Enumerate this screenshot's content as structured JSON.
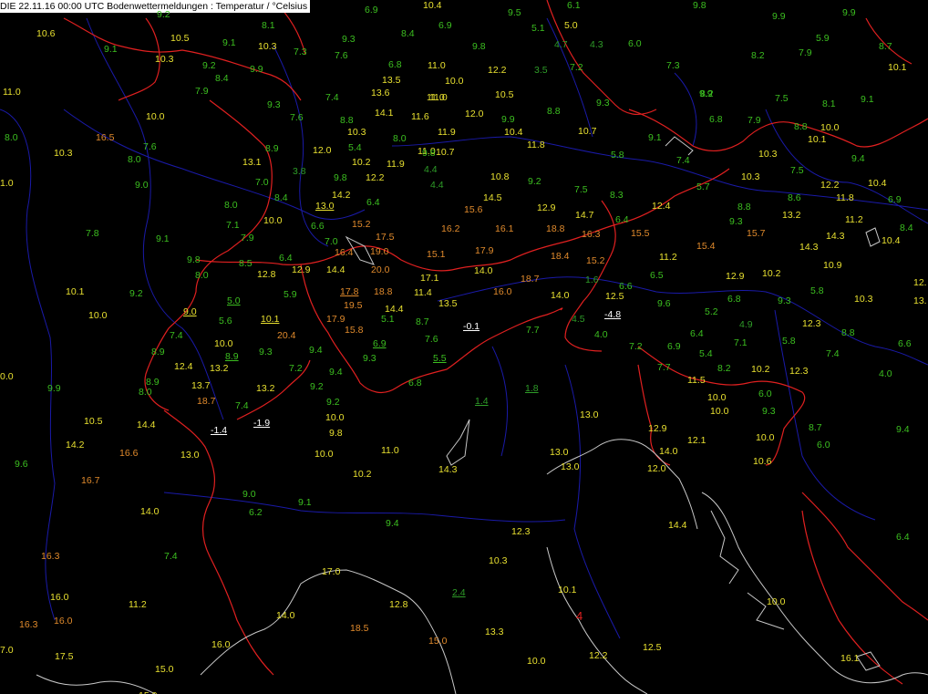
{
  "title": "DIE 22.11.16 00:00 UTC  Bodenwettermeldungen :  Temperatur / °Celsius",
  "colors": {
    "background": "#000000",
    "border_lines": "#e02020",
    "river_lines": "#1a1aa8",
    "coast_lines": "#c8c8c8",
    "green": "#3cbf20",
    "dark_green": "#2e9c28",
    "yellow": "#e8e030",
    "orange": "#e08a2c",
    "white": "#ffffff"
  },
  "marker": "4",
  "stations": [
    {
      "t": "9.2",
      "c": "g"
    },
    {
      "t": "6.9",
      "c": "g"
    },
    {
      "t": "10.4",
      "c": "y"
    },
    {
      "t": "9.5",
      "c": "g"
    },
    {
      "t": "6.1",
      "c": "g"
    },
    {
      "t": "9.9",
      "c": "g"
    },
    {
      "t": "9.9",
      "c": "g"
    },
    {
      "t": "10.6",
      "c": "y"
    },
    {
      "t": "8.1",
      "c": "g"
    },
    {
      "t": "9.3",
      "c": "g"
    },
    {
      "t": "8.4",
      "c": "g"
    },
    {
      "t": "6.9",
      "c": "g"
    },
    {
      "t": "5.1",
      "c": "g"
    },
    {
      "t": "5.0",
      "c": "y"
    },
    {
      "t": "9.8",
      "c": "g"
    },
    {
      "t": "10.5",
      "c": "y"
    },
    {
      "t": "9.1",
      "c": "g"
    },
    {
      "t": "10.3",
      "c": "y"
    },
    {
      "t": "7.3",
      "c": "g"
    },
    {
      "t": "4.7",
      "c": "dg"
    },
    {
      "t": "4.3",
      "c": "dg"
    },
    {
      "t": "6.0",
      "c": "g"
    },
    {
      "t": "5.9",
      "c": "g"
    },
    {
      "t": "8.7",
      "c": "g"
    },
    {
      "t": "9.1",
      "c": "g"
    },
    {
      "t": "10.3",
      "c": "y"
    },
    {
      "t": "7.6",
      "c": "g"
    },
    {
      "t": "9.8",
      "c": "g"
    },
    {
      "t": "8.2",
      "c": "g"
    },
    {
      "t": "7.9",
      "c": "g"
    },
    {
      "t": "9.2",
      "c": "g"
    },
    {
      "t": "9.9",
      "c": "g"
    },
    {
      "t": "6.8",
      "c": "g"
    },
    {
      "t": "11.0",
      "c": "y"
    },
    {
      "t": "12.2",
      "c": "y"
    },
    {
      "t": "3.5",
      "c": "dg"
    },
    {
      "t": "7.2",
      "c": "g"
    },
    {
      "t": "7.3",
      "c": "g"
    },
    {
      "t": "10.1",
      "c": "y"
    },
    {
      "t": "8.4",
      "c": "g"
    },
    {
      "t": "13.5",
      "c": "y"
    },
    {
      "t": "10.0",
      "c": "y"
    },
    {
      "t": "11.0",
      "c": "y"
    },
    {
      "t": "9.9",
      "c": "g"
    },
    {
      "t": "7.9",
      "c": "g"
    },
    {
      "t": "13.6",
      "c": "y"
    },
    {
      "t": "7.4",
      "c": "g"
    },
    {
      "t": "11.0",
      "c": "y"
    },
    {
      "t": "10.5",
      "c": "y"
    },
    {
      "t": "9.3",
      "c": "g"
    },
    {
      "t": "8.2",
      "c": "g"
    },
    {
      "t": "7.5",
      "c": "g"
    },
    {
      "t": "8.1",
      "c": "g"
    },
    {
      "t": "9.1",
      "c": "g"
    },
    {
      "t": "11.0",
      "c": "y"
    },
    {
      "t": "9.3",
      "c": "g"
    },
    {
      "t": "14.1",
      "c": "y"
    },
    {
      "t": "11.6",
      "c": "y"
    },
    {
      "t": "12.0",
      "c": "y"
    },
    {
      "t": "9.9",
      "c": "g"
    },
    {
      "t": "8.8",
      "c": "g"
    },
    {
      "t": "10.0",
      "c": "y"
    },
    {
      "t": "7.6",
      "c": "g"
    },
    {
      "t": "8.8",
      "c": "g"
    },
    {
      "t": "10.3",
      "c": "y"
    },
    {
      "t": "11.9",
      "c": "y"
    },
    {
      "t": "10.4",
      "c": "y"
    },
    {
      "t": "10.7",
      "c": "y"
    },
    {
      "t": "6.8",
      "c": "g"
    },
    {
      "t": "7.9",
      "c": "g"
    },
    {
      "t": "8.8",
      "c": "g"
    },
    {
      "t": "10.0",
      "c": "y"
    },
    {
      "t": "8.0",
      "c": "g"
    },
    {
      "t": "16.5",
      "c": "o"
    },
    {
      "t": "8.0",
      "c": "g"
    },
    {
      "t": "11.0",
      "c": "y"
    },
    {
      "t": "11.8",
      "c": "y"
    },
    {
      "t": "9.1",
      "c": "g"
    },
    {
      "t": "10.1",
      "c": "y"
    },
    {
      "t": "10.3",
      "c": "y"
    },
    {
      "t": "7.6",
      "c": "g"
    },
    {
      "t": "8.9",
      "c": "g"
    },
    {
      "t": "12.0",
      "c": "y"
    },
    {
      "t": "5.4",
      "c": "g"
    },
    {
      "t": "9.8",
      "c": "g"
    },
    {
      "t": "5.8",
      "c": "g"
    },
    {
      "t": "7.4",
      "c": "g"
    },
    {
      "t": "10.3",
      "c": "y"
    },
    {
      "t": "9.4",
      "c": "g"
    },
    {
      "t": "8.0",
      "c": "g"
    },
    {
      "t": "13.1",
      "c": "y"
    },
    {
      "t": "10.2",
      "c": "y"
    },
    {
      "t": "11.9",
      "c": "y"
    },
    {
      "t": "10.7",
      "c": "y"
    },
    {
      "t": "3.8",
      "c": "dg"
    },
    {
      "t": "4.4",
      "c": "dg"
    },
    {
      "t": "7.5",
      "c": "g"
    },
    {
      "t": "1.0",
      "c": "y"
    },
    {
      "t": "9.0",
      "c": "g"
    },
    {
      "t": "7.0",
      "c": "g"
    },
    {
      "t": "9.8",
      "c": "g"
    },
    {
      "t": "12.2",
      "c": "y"
    },
    {
      "t": "4.4",
      "c": "dg"
    },
    {
      "t": "10.8",
      "c": "y"
    },
    {
      "t": "9.2",
      "c": "g"
    },
    {
      "t": "5.7",
      "c": "g"
    },
    {
      "t": "10.3",
      "c": "y"
    },
    {
      "t": "12.2",
      "c": "y"
    },
    {
      "t": "10.4",
      "c": "y"
    },
    {
      "t": "8.4",
      "c": "g"
    },
    {
      "t": "14.2",
      "c": "y"
    },
    {
      "t": "14.5",
      "c": "y"
    },
    {
      "t": "7.5",
      "c": "g"
    },
    {
      "t": "8.3",
      "c": "g"
    },
    {
      "t": "8.6",
      "c": "g"
    },
    {
      "t": "11.8",
      "c": "y"
    },
    {
      "t": "6.9",
      "c": "g"
    },
    {
      "t": "8.0",
      "c": "g"
    },
    {
      "t": "13.0",
      "c": "y",
      "u": true
    },
    {
      "t": "6.4",
      "c": "g"
    },
    {
      "t": "15.6",
      "c": "o"
    },
    {
      "t": "12.9",
      "c": "y"
    },
    {
      "t": "12.4",
      "c": "y"
    },
    {
      "t": "8.8",
      "c": "g"
    },
    {
      "t": "13.2",
      "c": "y"
    },
    {
      "t": "10.0",
      "c": "y"
    },
    {
      "t": "14.7",
      "c": "y"
    },
    {
      "t": "6.4",
      "c": "g"
    },
    {
      "t": "9.3",
      "c": "g"
    },
    {
      "t": "11.2",
      "c": "y"
    },
    {
      "t": "8.4",
      "c": "g"
    },
    {
      "t": "7.1",
      "c": "g"
    },
    {
      "t": "6.6",
      "c": "g"
    },
    {
      "t": "15.2",
      "c": "o"
    },
    {
      "t": "16.2",
      "c": "o"
    },
    {
      "t": "16.1",
      "c": "o"
    },
    {
      "t": "18.8",
      "c": "o"
    },
    {
      "t": "15.5",
      "c": "o"
    },
    {
      "t": "15.7",
      "c": "o"
    },
    {
      "t": "7.8",
      "c": "g"
    },
    {
      "t": "9.1",
      "c": "g"
    },
    {
      "t": "7.9",
      "c": "g"
    },
    {
      "t": "7.0",
      "c": "g"
    },
    {
      "t": "17.5",
      "c": "o"
    },
    {
      "t": "16.3",
      "c": "o"
    },
    {
      "t": "14.3",
      "c": "y"
    },
    {
      "t": "10.4",
      "c": "y"
    },
    {
      "t": "16.4",
      "c": "o"
    },
    {
      "t": "19.0",
      "c": "o"
    },
    {
      "t": "15.1",
      "c": "o"
    },
    {
      "t": "17.9",
      "c": "o"
    },
    {
      "t": "15.4",
      "c": "o"
    },
    {
      "t": "14.3",
      "c": "y"
    },
    {
      "t": "9.8",
      "c": "g"
    },
    {
      "t": "8.5",
      "c": "g"
    },
    {
      "t": "6.4",
      "c": "g"
    },
    {
      "t": "18.4",
      "c": "o"
    },
    {
      "t": "11.2",
      "c": "y"
    },
    {
      "t": "10.9",
      "c": "y"
    },
    {
      "t": "8.0",
      "c": "g"
    },
    {
      "t": "12.8",
      "c": "y"
    },
    {
      "t": "12.9",
      "c": "y"
    },
    {
      "t": "14.4",
      "c": "y"
    },
    {
      "t": "20.0",
      "c": "o"
    },
    {
      "t": "14.0",
      "c": "y"
    },
    {
      "t": "15.2",
      "c": "o"
    },
    {
      "t": "6.5",
      "c": "g"
    },
    {
      "t": "12.9",
      "c": "y"
    },
    {
      "t": "10.2",
      "c": "y"
    },
    {
      "t": "17.1",
      "c": "y"
    },
    {
      "t": "18.7",
      "c": "o"
    },
    {
      "t": "1.6",
      "c": "dg"
    },
    {
      "t": "6.6",
      "c": "g"
    },
    {
      "t": "5.8",
      "c": "g"
    },
    {
      "t": "12.",
      "c": "y"
    },
    {
      "t": "10.1",
      "c": "y"
    },
    {
      "t": "9.2",
      "c": "g"
    },
    {
      "t": "5.9",
      "c": "g"
    },
    {
      "t": "17.8",
      "c": "o",
      "u": true
    },
    {
      "t": "18.8",
      "c": "o"
    },
    {
      "t": "11.4",
      "c": "y"
    },
    {
      "t": "16.0",
      "c": "o"
    },
    {
      "t": "14.0",
      "c": "y"
    },
    {
      "t": "12.5",
      "c": "y"
    },
    {
      "t": "6.8",
      "c": "g"
    },
    {
      "t": "9.3",
      "c": "g"
    },
    {
      "t": "10.3",
      "c": "y"
    },
    {
      "t": "5.0",
      "c": "g",
      "u": true
    },
    {
      "t": "19.5",
      "c": "o"
    },
    {
      "t": "13.5",
      "c": "y"
    },
    {
      "t": "9.6",
      "c": "g"
    },
    {
      "t": "13.",
      "c": "y"
    },
    {
      "t": "10.0",
      "c": "y"
    },
    {
      "t": "9.0",
      "c": "y",
      "u": true
    },
    {
      "t": "14.4",
      "c": "y"
    },
    {
      "t": "-4.8",
      "c": "w",
      "u": true
    },
    {
      "t": "5.2",
      "c": "g"
    },
    {
      "t": "5.6",
      "c": "g"
    },
    {
      "t": "10.1",
      "c": "y",
      "u": true
    },
    {
      "t": "17.9",
      "c": "o"
    },
    {
      "t": "5.1",
      "c": "g"
    },
    {
      "t": "8.7",
      "c": "g"
    },
    {
      "t": "4.5",
      "c": "dg"
    },
    {
      "t": "12.3",
      "c": "y"
    },
    {
      "t": "-0.1",
      "c": "w",
      "u": true
    },
    {
      "t": "4.9",
      "c": "dg"
    },
    {
      "t": "15.8",
      "c": "o"
    },
    {
      "t": "7.7",
      "c": "g"
    },
    {
      "t": "8.8",
      "c": "g"
    },
    {
      "t": "7.4",
      "c": "g"
    },
    {
      "t": "20.4",
      "c": "o"
    },
    {
      "t": "7.6",
      "c": "g"
    },
    {
      "t": "4.0",
      "c": "g"
    },
    {
      "t": "6.4",
      "c": "g"
    },
    {
      "t": "5.8",
      "c": "g"
    },
    {
      "t": "10.0",
      "c": "y"
    },
    {
      "t": "6.9",
      "c": "g",
      "u": true
    },
    {
      "t": "7.2",
      "c": "g"
    },
    {
      "t": "6.9",
      "c": "g"
    },
    {
      "t": "7.1",
      "c": "g"
    },
    {
      "t": "6.6",
      "c": "g"
    },
    {
      "t": "8.9",
      "c": "g"
    },
    {
      "t": "8.9",
      "c": "g",
      "u": true
    },
    {
      "t": "9.3",
      "c": "g"
    },
    {
      "t": "9.4",
      "c": "g"
    },
    {
      "t": "5.4",
      "c": "g"
    },
    {
      "t": "7.4",
      "c": "g"
    },
    {
      "t": "0.0",
      "c": "y"
    },
    {
      "t": "12.4",
      "c": "y"
    },
    {
      "t": "13.2",
      "c": "y"
    },
    {
      "t": "7.2",
      "c": "g"
    },
    {
      "t": "9.3",
      "c": "g"
    },
    {
      "t": "5.5",
      "c": "g",
      "u": true
    },
    {
      "t": "7.7",
      "c": "g"
    },
    {
      "t": "8.2",
      "c": "g"
    },
    {
      "t": "10.2",
      "c": "y"
    },
    {
      "t": "12.3",
      "c": "y"
    },
    {
      "t": "4.0",
      "c": "g"
    },
    {
      "t": "8.9",
      "c": "g"
    },
    {
      "t": "9.4",
      "c": "g"
    },
    {
      "t": "11.5",
      "c": "y"
    },
    {
      "t": "9.9",
      "c": "g"
    },
    {
      "t": "8.0",
      "c": "g"
    },
    {
      "t": "13.7",
      "c": "y"
    },
    {
      "t": "13.2",
      "c": "y"
    },
    {
      "t": "9.2",
      "c": "g"
    },
    {
      "t": "6.8",
      "c": "g"
    },
    {
      "t": "1.8",
      "c": "dg",
      "u": true
    },
    {
      "t": "6.0",
      "c": "g"
    },
    {
      "t": "18.7",
      "c": "o"
    },
    {
      "t": "7.4",
      "c": "g"
    },
    {
      "t": "9.2",
      "c": "g"
    },
    {
      "t": "1.4",
      "c": "dg",
      "u": true
    },
    {
      "t": "10.0",
      "c": "y"
    },
    {
      "t": "10.5",
      "c": "y"
    },
    {
      "t": "14.4",
      "c": "y"
    },
    {
      "t": "-1.4",
      "c": "w",
      "u": true
    },
    {
      "t": "-1.9",
      "c": "w",
      "u": true
    },
    {
      "t": "10.0",
      "c": "y"
    },
    {
      "t": "13.0",
      "c": "y"
    },
    {
      "t": "10.0",
      "c": "y"
    },
    {
      "t": "9.3",
      "c": "g"
    },
    {
      "t": "8.7",
      "c": "g"
    },
    {
      "t": "9.4",
      "c": "g"
    },
    {
      "t": "9.8",
      "c": "y"
    },
    {
      "t": "12.9",
      "c": "y"
    },
    {
      "t": "14.2",
      "c": "y"
    },
    {
      "t": "16.6",
      "c": "o"
    },
    {
      "t": "13.0",
      "c": "y"
    },
    {
      "t": "10.0",
      "c": "y"
    },
    {
      "t": "11.0",
      "c": "y"
    },
    {
      "t": "13.0",
      "c": "y"
    },
    {
      "t": "14.0",
      "c": "y"
    },
    {
      "t": "12.1",
      "c": "y"
    },
    {
      "t": "10.0",
      "c": "y"
    },
    {
      "t": "6.0",
      "c": "g"
    },
    {
      "t": "9.6",
      "c": "g"
    },
    {
      "t": "14.3",
      "c": "y"
    },
    {
      "t": "13.0",
      "c": "y"
    },
    {
      "t": "12.0",
      "c": "y"
    },
    {
      "t": "10.6",
      "c": "y"
    },
    {
      "t": "16.7",
      "c": "o"
    },
    {
      "t": "10.2",
      "c": "y"
    },
    {
      "t": "9.0",
      "c": "g"
    },
    {
      "t": "9.1",
      "c": "g"
    },
    {
      "t": "14.0",
      "c": "y"
    },
    {
      "t": "6.2",
      "c": "g"
    },
    {
      "t": "9.4",
      "c": "g"
    },
    {
      "t": "14.4",
      "c": "y"
    },
    {
      "t": "12.3",
      "c": "y"
    },
    {
      "t": "6.4",
      "c": "g"
    },
    {
      "t": "16.3",
      "c": "o"
    },
    {
      "t": "7.4",
      "c": "g"
    },
    {
      "t": "10.3",
      "c": "y"
    },
    {
      "t": "17.0",
      "c": "y"
    },
    {
      "t": "16.0",
      "c": "y"
    },
    {
      "t": "11.2",
      "c": "y"
    },
    {
      "t": "12.8",
      "c": "y"
    },
    {
      "t": "2.4",
      "c": "dg",
      "u": true
    },
    {
      "t": "10.1",
      "c": "y"
    },
    {
      "t": "10.0",
      "c": "y"
    },
    {
      "t": "16.3",
      "c": "o"
    },
    {
      "t": "16.0",
      "c": "o"
    },
    {
      "t": "14.0",
      "c": "y"
    },
    {
      "t": "18.5",
      "c": "o"
    },
    {
      "t": "13.3",
      "c": "y"
    },
    {
      "t": "15.0",
      "c": "o"
    },
    {
      "t": "16.0",
      "c": "y"
    },
    {
      "t": "12.5",
      "c": "y"
    },
    {
      "t": "7.0",
      "c": "y"
    },
    {
      "t": "17.5",
      "c": "y"
    },
    {
      "t": "12.2",
      "c": "y"
    },
    {
      "t": "10.0",
      "c": "y"
    },
    {
      "t": "16.1",
      "c": "y"
    },
    {
      "t": "15.0",
      "c": "y"
    },
    {
      "t": "15.0",
      "c": "y"
    }
  ]
}
